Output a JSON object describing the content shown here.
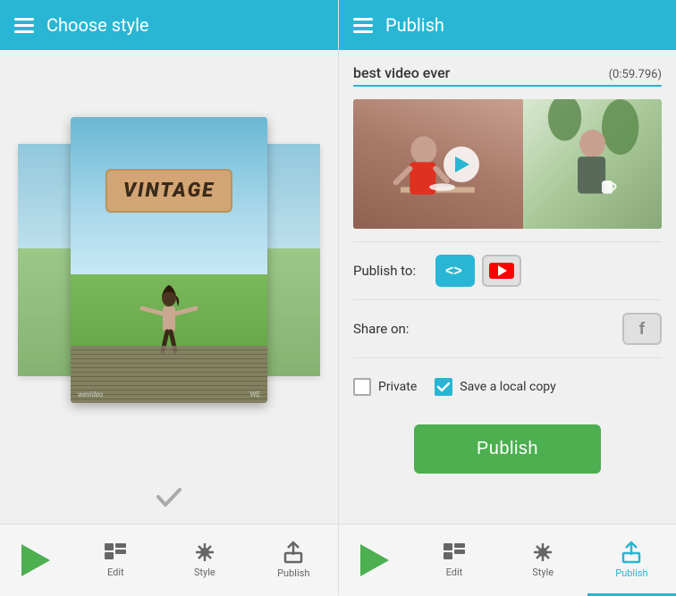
{
  "left": {
    "header_title": "Choose style",
    "poster_text": "VINTAGE",
    "watermark_left": "wevideo",
    "watermark_right": "WE",
    "checkmark": "✓"
  },
  "right": {
    "header_title": "Publish",
    "video_title": "best video ever",
    "video_duration": "(0:59.796)",
    "publish_to_label": "Publish to:",
    "share_on_label": "Share on:",
    "private_label": "Private",
    "save_copy_label": "Save a local copy",
    "publish_button": "Publish"
  },
  "bottom_nav": {
    "edit_label": "Edit",
    "style_label": "Style",
    "publish_label": "Publish"
  },
  "colors": {
    "header_bg": "#29b6d4",
    "active_btn": "#29b6d4",
    "publish_btn": "#4caf50",
    "play_btn": "#4caf50"
  }
}
